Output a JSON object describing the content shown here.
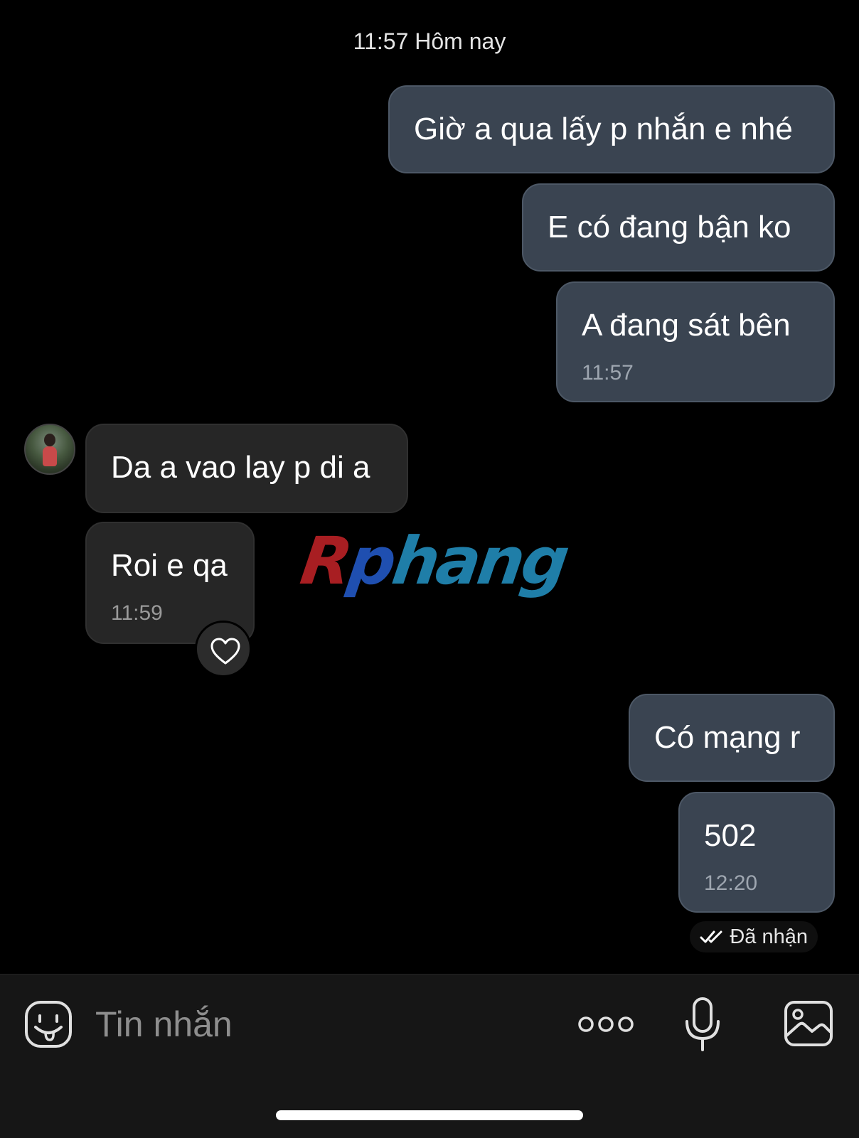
{
  "header": {
    "timestamp": "11:57 Hôm nay"
  },
  "messages": [
    {
      "direction": "out",
      "text": "Giờ a qua lấy p nhắn e nhé",
      "time": ""
    },
    {
      "direction": "out",
      "text": "E có đang bận ko",
      "time": ""
    },
    {
      "direction": "out",
      "text": "A đang sát bên",
      "time": "11:57"
    },
    {
      "direction": "in",
      "text": "Da a vao lay p di a",
      "time": ""
    },
    {
      "direction": "in",
      "text": "Roi e qa",
      "time": "11:59",
      "reaction": "heart-icon"
    },
    {
      "direction": "out",
      "text": "Có mạng r",
      "time": ""
    },
    {
      "direction": "out",
      "text": "502",
      "time": "12:20"
    }
  ],
  "watermark": {
    "first": "R",
    "second": "p",
    "rest": "hang"
  },
  "status": {
    "receipt_icon": "double-check-icon",
    "receipt_label": "Đã nhận"
  },
  "composer": {
    "placeholder": "Tin nhắn",
    "icons": [
      "emoji-icon",
      "more-icon",
      "microphone-icon",
      "image-gallery-icon"
    ]
  },
  "colors": {
    "background": "#000000",
    "outgoing_bubble": "#3a4451",
    "incoming_bubble": "#262626",
    "composer_bar": "#161616"
  }
}
